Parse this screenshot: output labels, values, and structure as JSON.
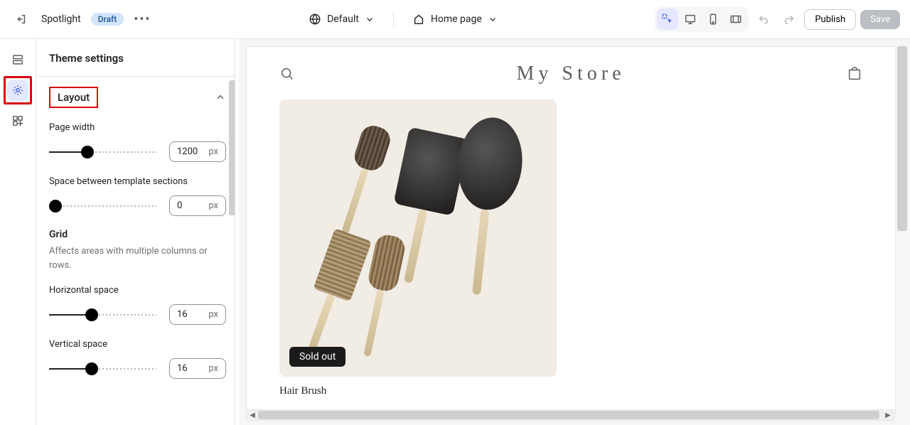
{
  "topbar": {
    "theme_name": "Spotlight",
    "draft_label": "Draft",
    "viewport_label": "Default",
    "page_label": "Home page",
    "publish_label": "Publish",
    "save_label": "Save"
  },
  "sidebar": {
    "title": "Theme settings",
    "section": {
      "layout": {
        "title": "Layout",
        "page_width_label": "Page width",
        "page_width_value": "1200",
        "page_width_unit": "px",
        "space_sections_label": "Space between template sections",
        "space_sections_value": "0",
        "space_sections_unit": "px",
        "grid_header": "Grid",
        "grid_desc": "Affects areas with multiple columns or rows.",
        "hspace_label": "Horizontal space",
        "hspace_value": "16",
        "hspace_unit": "px",
        "vspace_label": "Vertical space",
        "vspace_value": "16",
        "vspace_unit": "px"
      }
    }
  },
  "preview": {
    "store_title": "My Store",
    "sold_out_label": "Sold out",
    "product_name": "Hair Brush"
  }
}
